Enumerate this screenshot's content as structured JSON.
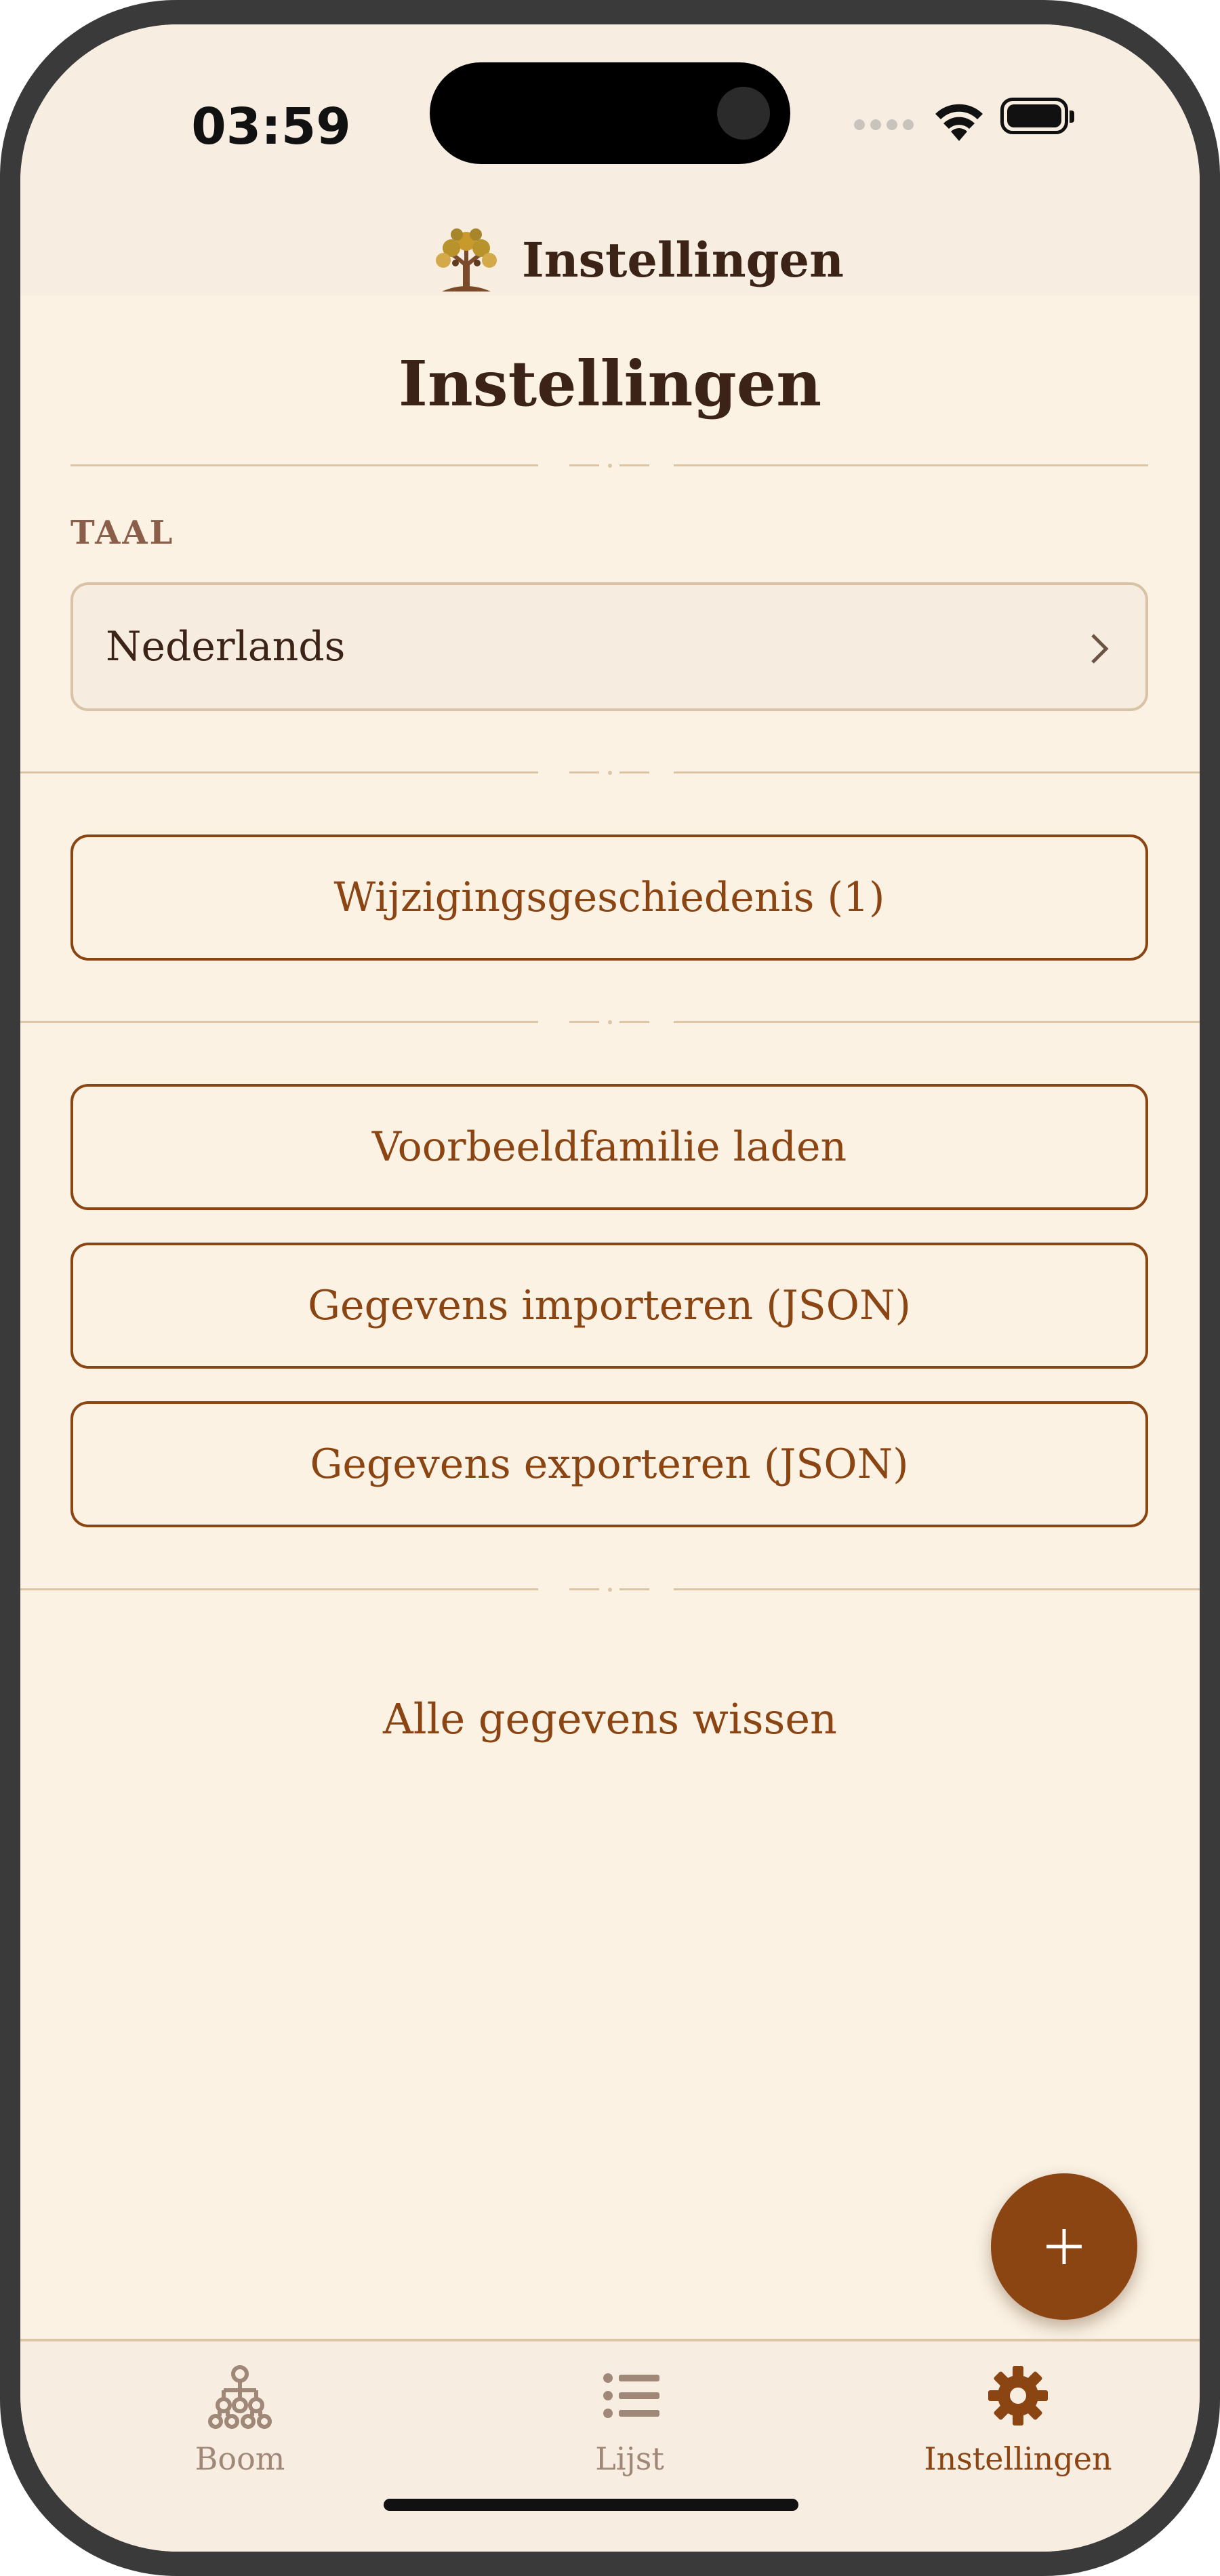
{
  "status_bar": {
    "time": "03:59"
  },
  "header": {
    "title": "Instellingen",
    "logo_icon": "tree-logo-icon"
  },
  "page": {
    "title": "Instellingen"
  },
  "language": {
    "label": "TAAL",
    "value": "Nederlands"
  },
  "buttons": {
    "history": "Wijzigingsgeschiedenis (1)",
    "load_example": "Voorbeeldfamilie laden",
    "import": "Gegevens importeren (JSON)",
    "export": "Gegevens exporteren (JSON)",
    "clear_all": "Alle gegevens wissen"
  },
  "tabs": [
    {
      "label": "Boom",
      "icon": "family-tree-icon",
      "active": false
    },
    {
      "label": "Lijst",
      "icon": "list-icon",
      "active": false
    },
    {
      "label": "Instellingen",
      "icon": "gear-icon",
      "active": true
    }
  ],
  "colors": {
    "accent": "#8b4513",
    "background": "#fbf2e4",
    "header_background": "#f8ede1",
    "text_dark": "#3b2317",
    "divider": "#dcc4a4"
  }
}
